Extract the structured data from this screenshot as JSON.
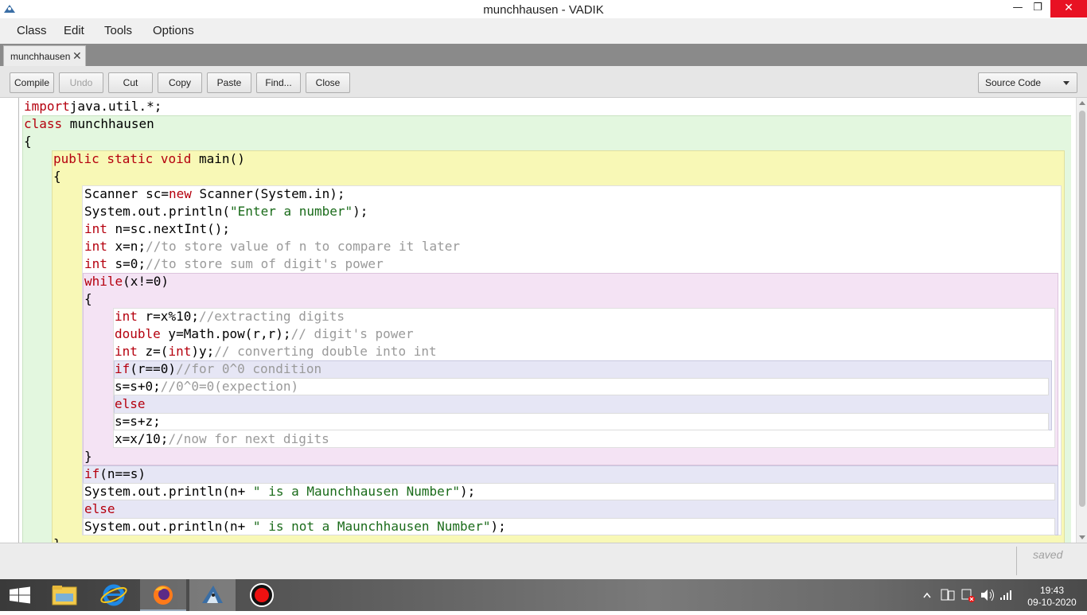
{
  "window": {
    "title": "munchhausen - VADIK",
    "minimize": "—",
    "maximize": "❐",
    "close": "✕"
  },
  "menu": [
    "Class",
    "Edit",
    "Tools",
    "Options"
  ],
  "tab": {
    "label": "munchhausen",
    "close": "✕"
  },
  "toolbar": {
    "compile": "Compile",
    "undo": "Undo",
    "cut": "Cut",
    "copy": "Copy",
    "paste": "Paste",
    "find": "Find...",
    "close": "Close",
    "view_select": "Source Code"
  },
  "code": [
    {
      "indent": 0,
      "parts": [
        [
          "kw",
          "import"
        ],
        [
          "",
          "java.util.*;"
        ]
      ]
    },
    {
      "indent": 0,
      "parts": [
        [
          "kw",
          "class"
        ],
        [
          "",
          " munchhausen"
        ]
      ]
    },
    {
      "indent": 0,
      "parts": [
        [
          "",
          "{"
        ]
      ]
    },
    {
      "indent": 1,
      "parts": [
        [
          "kw",
          "public static void"
        ],
        [
          "",
          " main()"
        ]
      ]
    },
    {
      "indent": 1,
      "parts": [
        [
          "",
          "{"
        ]
      ]
    },
    {
      "indent": 2,
      "parts": [
        [
          "",
          "Scanner sc="
        ],
        [
          "kw",
          "new"
        ],
        [
          "",
          " Scanner(System.in);"
        ]
      ]
    },
    {
      "indent": 2,
      "parts": [
        [
          "",
          "System.out.println("
        ],
        [
          "str",
          "\"Enter a number\""
        ],
        [
          "",
          ");"
        ]
      ]
    },
    {
      "indent": 2,
      "parts": [
        [
          "kw",
          "int"
        ],
        [
          "",
          " n=sc.nextInt();"
        ]
      ]
    },
    {
      "indent": 2,
      "parts": [
        [
          "kw",
          "int"
        ],
        [
          "",
          " x=n;"
        ],
        [
          "cm",
          "//to store value of n to compare it later"
        ]
      ]
    },
    {
      "indent": 2,
      "parts": [
        [
          "kw",
          "int"
        ],
        [
          "",
          " s=0;"
        ],
        [
          "cm",
          "//to store sum of digit's power"
        ]
      ]
    },
    {
      "indent": 2,
      "parts": [
        [
          "kw",
          "while"
        ],
        [
          "",
          "(x!=0)"
        ]
      ]
    },
    {
      "indent": 2,
      "parts": [
        [
          "",
          "{"
        ]
      ]
    },
    {
      "indent": 3,
      "parts": [
        [
          "kw",
          "int"
        ],
        [
          "",
          " r=x%10;"
        ],
        [
          "cm",
          "//extracting digits"
        ]
      ]
    },
    {
      "indent": 3,
      "parts": [
        [
          "kw",
          "double"
        ],
        [
          "",
          " y=Math.pow(r,r);"
        ],
        [
          "cm",
          "// digit's power"
        ]
      ]
    },
    {
      "indent": 3,
      "parts": [
        [
          "kw",
          "int"
        ],
        [
          "",
          " z=("
        ],
        [
          "kw",
          "int"
        ],
        [
          "",
          ")y;"
        ],
        [
          "cm",
          "// converting double into int"
        ]
      ]
    },
    {
      "indent": 3,
      "parts": [
        [
          "kw",
          "if"
        ],
        [
          "",
          "(r==0)"
        ],
        [
          "cm",
          "//for 0^0 condition"
        ]
      ]
    },
    {
      "indent": 3,
      "parts": [
        [
          "",
          "s=s+0;"
        ],
        [
          "cm",
          "//0^0=0(expection)"
        ]
      ]
    },
    {
      "indent": 3,
      "parts": [
        [
          "kw",
          "else"
        ]
      ]
    },
    {
      "indent": 3,
      "parts": [
        [
          "",
          "s=s+z;"
        ]
      ]
    },
    {
      "indent": 3,
      "parts": [
        [
          "",
          "x=x/10;"
        ],
        [
          "cm",
          "//now for next digits"
        ]
      ]
    },
    {
      "indent": 2,
      "parts": [
        [
          "",
          "}"
        ]
      ]
    },
    {
      "indent": 2,
      "parts": [
        [
          "kw",
          "if"
        ],
        [
          "",
          "(n==s)"
        ]
      ]
    },
    {
      "indent": 2,
      "parts": [
        [
          "",
          "System.out.println(n+ "
        ],
        [
          "str",
          "\" is a Maunchhausen Number\""
        ],
        [
          "",
          ");"
        ]
      ]
    },
    {
      "indent": 2,
      "parts": [
        [
          "kw",
          "else"
        ]
      ]
    },
    {
      "indent": 2,
      "parts": [
        [
          "",
          "System.out.println(n+ "
        ],
        [
          "str",
          "\" is not a Maunchhausen Number\""
        ],
        [
          "",
          ");"
        ]
      ]
    },
    {
      "indent": 1,
      "parts": [
        [
          "",
          "}"
        ]
      ]
    }
  ],
  "status": {
    "text": "saved"
  },
  "taskbar": {
    "apps": [
      "windows-start-icon",
      "file-explorer-icon",
      "internet-explorer-icon",
      "firefox-icon",
      "bluej-icon",
      "screen-recorder-icon"
    ],
    "clock_time": "19:43",
    "clock_date": "09-10-2020"
  },
  "colors": {
    "keyword": "#b5000e",
    "string": "#1a6b1a",
    "comment": "#9a9a9a",
    "class_scope": "#e3f7df",
    "method_scope": "#f8f8b6",
    "loop_scope": "#f4e3f4",
    "if_scope": "#e6e6f5"
  }
}
